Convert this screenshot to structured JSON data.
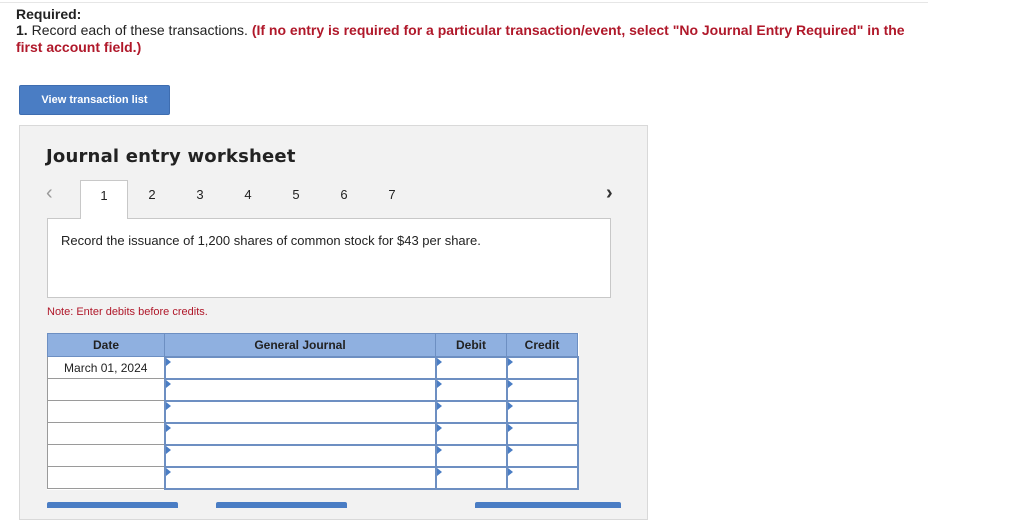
{
  "required": {
    "title": "Required:",
    "number": "1.",
    "instruction": "Record each of these transactions.",
    "note": "(If no entry is required for a particular transaction/event, select \"No Journal Entry Required\" in the first account field.)"
  },
  "view_button": "View transaction list",
  "worksheet": {
    "title": "Journal entry worksheet",
    "prev_icon": "chevron-left-icon",
    "next_icon": "chevron-right-icon",
    "tabs": [
      "1",
      "2",
      "3",
      "4",
      "5",
      "6",
      "7"
    ],
    "active_tab": "1",
    "description": "Record the issuance of 1,200 shares of common stock for $43 per share.",
    "note": "Note: Enter debits before credits.",
    "table": {
      "headers": {
        "date": "Date",
        "journal": "General Journal",
        "debit": "Debit",
        "credit": "Credit"
      },
      "rows": [
        {
          "date": "March 01, 2024",
          "journal": "",
          "debit": "",
          "credit": ""
        },
        {
          "date": "",
          "journal": "",
          "debit": "",
          "credit": ""
        },
        {
          "date": "",
          "journal": "",
          "debit": "",
          "credit": ""
        },
        {
          "date": "",
          "journal": "",
          "debit": "",
          "credit": ""
        },
        {
          "date": "",
          "journal": "",
          "debit": "",
          "credit": ""
        },
        {
          "date": "",
          "journal": "",
          "debit": "",
          "credit": ""
        }
      ]
    }
  },
  "colors": {
    "accent": "#4a7dc4",
    "header": "#8fb0e0",
    "warning": "#b0182a"
  }
}
